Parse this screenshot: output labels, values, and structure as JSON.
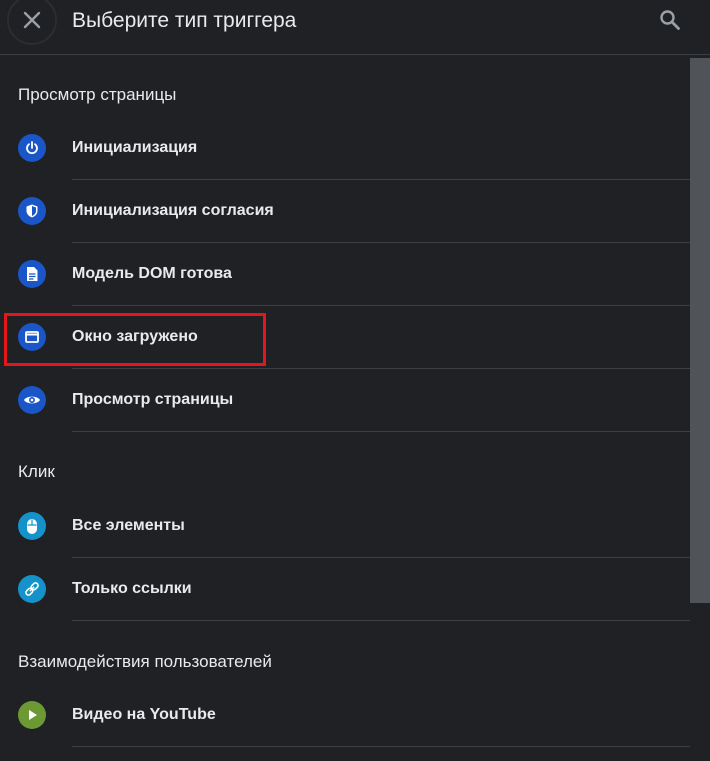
{
  "header": {
    "title": "Выберите тип триггера"
  },
  "sections": [
    {
      "title": "Просмотр страницы",
      "items": [
        {
          "label": "Инициализация",
          "icon": "power-icon",
          "color": "#1a56c8"
        },
        {
          "label": "Инициализация согласия",
          "icon": "shield-icon",
          "color": "#1a56c8"
        },
        {
          "label": "Модель DOM готова",
          "icon": "document-icon",
          "color": "#1a56c8"
        },
        {
          "label": "Окно загружено",
          "icon": "window-icon",
          "color": "#1a56c8"
        },
        {
          "label": "Просмотр страницы",
          "icon": "eye-icon",
          "color": "#1a56c8"
        }
      ]
    },
    {
      "title": "Клик",
      "items": [
        {
          "label": "Все элементы",
          "icon": "mouse-icon",
          "color": "#1592c9"
        },
        {
          "label": "Только ссылки",
          "icon": "link-icon",
          "color": "#1592c9"
        }
      ]
    },
    {
      "title": "Взаимодействия пользователей",
      "items": [
        {
          "label": "Видео на YouTube",
          "icon": "play-icon",
          "color": "#6c9933"
        }
      ]
    }
  ],
  "colors": {
    "background": "#202124",
    "highlight": "#e5161b",
    "text": "#e8eaed"
  }
}
